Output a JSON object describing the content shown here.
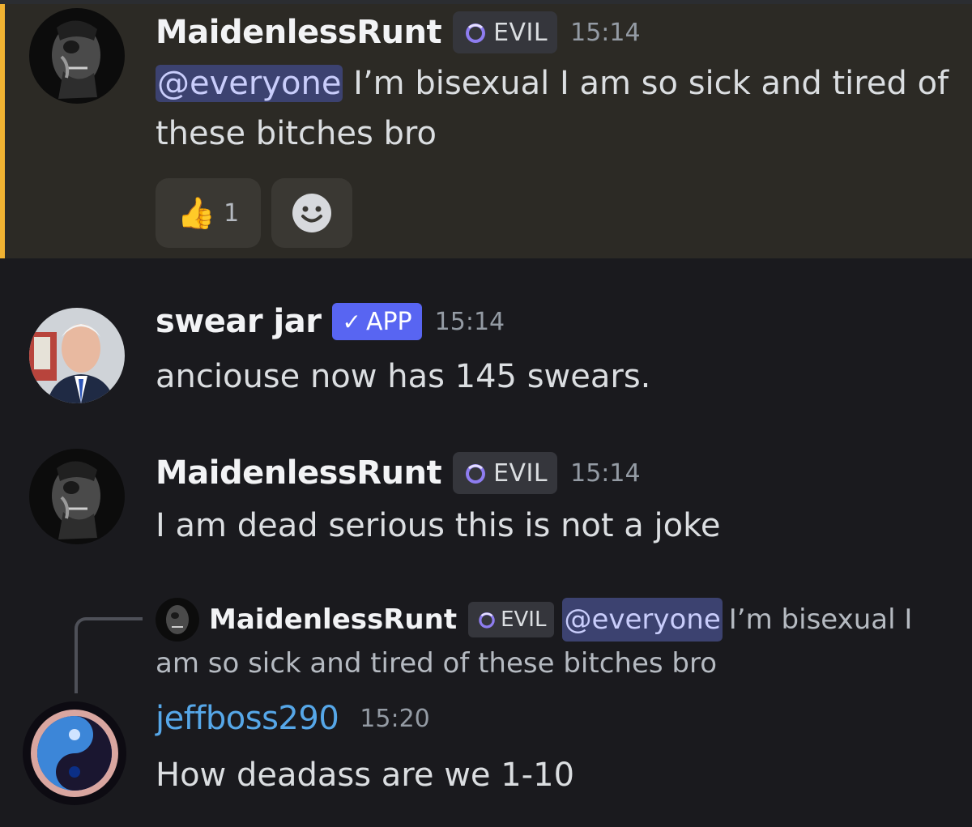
{
  "messages": [
    {
      "username": "MaidenlessRunt",
      "tag": "EVIL",
      "time": "15:14",
      "mention": "@everyone",
      "text_line1": " I’m bisexual I am so sick and tired of",
      "text_line2": "these bitches bro",
      "reaction": {
        "emoji": "👍",
        "count": "1"
      }
    },
    {
      "username": "swear jar",
      "tag": "APP",
      "tag_check": "✓",
      "time": "15:14",
      "text": "anciouse now has 145 swears."
    },
    {
      "username": "MaidenlessRunt",
      "tag": "EVIL",
      "time": "15:14",
      "text": "I am dead serious this is not a joke"
    },
    {
      "reply": {
        "username": "MaidenlessRunt",
        "tag": "EVIL",
        "mention": "@everyone",
        "text_line1": "I’m bisexual I",
        "text_line2": "am so sick and tired of these bitches bro"
      },
      "username": "jeffboss290",
      "time": "15:20",
      "text": "How deadass are we 1-10"
    }
  ],
  "colors": {
    "background": "#1a1a1e",
    "highlight": "#2c2a25",
    "highlight_bar": "#f0b232",
    "mention_bg": "#3c4270",
    "app_badge": "#5865f2",
    "username_blue": "#56a7e8"
  }
}
